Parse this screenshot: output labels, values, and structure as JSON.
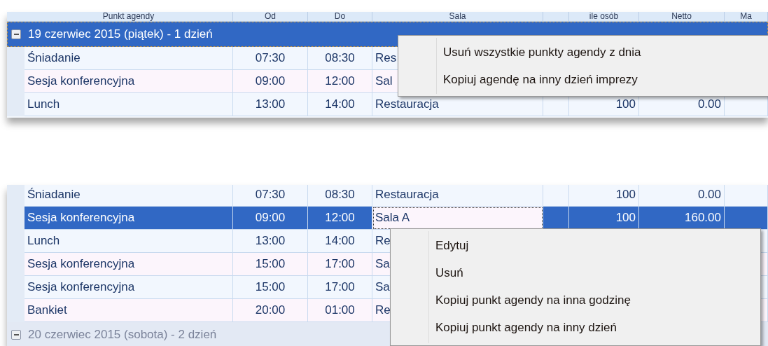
{
  "panels": [
    {
      "columns": [
        "Punkt agendy",
        "Od",
        "Do",
        "Sala",
        "",
        "ile osób",
        "Netto",
        "Ma"
      ],
      "sections": [
        {
          "kind": "group",
          "label": "19 czerwiec 2015 (piątek) - 1 dzień",
          "expanded": true,
          "selected": true
        },
        {
          "kind": "row",
          "selected": false,
          "name": "Śniadanie",
          "from": "07:30",
          "to": "08:30",
          "room": "Res"
        },
        {
          "kind": "row",
          "selected": false,
          "name": "Sesja konferencyjna",
          "from": "09:00",
          "to": "12:00",
          "room": "Sal"
        },
        {
          "kind": "row",
          "selected": false,
          "name": "Lunch",
          "from": "13:00",
          "to": "14:00",
          "room": "Restauracja",
          "people": "100",
          "net": "0.00"
        }
      ],
      "menu": {
        "items": [
          "Usuń wszystkie punkty agendy z dnia",
          "Kopiuj agendę na inny dzień imprezy"
        ]
      }
    },
    {
      "sections": [
        {
          "kind": "row",
          "selected": false,
          "name": "Śniadanie",
          "from": "07:30",
          "to": "08:30",
          "room": "Restauracja",
          "people": "100",
          "net": "0.00"
        },
        {
          "kind": "row",
          "selected": true,
          "name": "Sesja konferencyjna",
          "from": "09:00",
          "to": "12:00",
          "room": "Sala A",
          "people": "100",
          "net": "160.00"
        },
        {
          "kind": "row",
          "selected": false,
          "name": "Lunch",
          "from": "13:00",
          "to": "14:00",
          "room": "Re"
        },
        {
          "kind": "row",
          "selected": false,
          "name": "Sesja konferencyjna",
          "from": "15:00",
          "to": "17:00",
          "room": "Sa"
        },
        {
          "kind": "row",
          "selected": false,
          "name": "Sesja konferencyjna",
          "from": "15:00",
          "to": "17:00",
          "room": "Sa"
        },
        {
          "kind": "row",
          "selected": false,
          "name": "Bankiet",
          "from": "20:00",
          "to": "01:00",
          "room": "Re"
        },
        {
          "kind": "group",
          "label": "20 czerwiec 2015 (sobota) - 2 dzień",
          "expanded": true,
          "selected": false
        }
      ],
      "menu": {
        "items": [
          "Edytuj",
          "Usuń",
          "Kopiuj punkt agendy na inna godzinę",
          "Kopiuj punkt agendy na inny dzień"
        ]
      }
    }
  ]
}
